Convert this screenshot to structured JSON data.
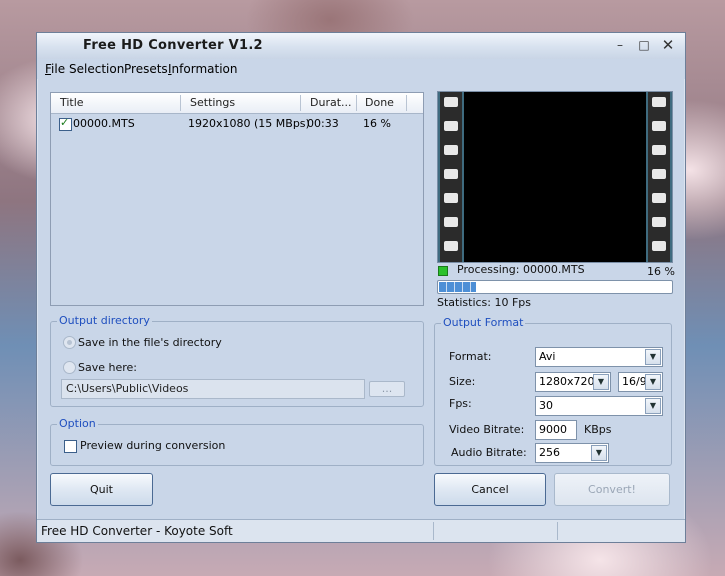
{
  "window": {
    "title": "Free HD Converter V1.2"
  },
  "menu": [
    {
      "label": "File",
      "accel": "F",
      "rest": "ile"
    },
    {
      "label": "Selection"
    },
    {
      "label": "Presets"
    },
    {
      "label": "Information",
      "accel": "I",
      "rest": "nformation"
    }
  ],
  "list": {
    "columns": [
      "Title",
      "Settings",
      "Durat...",
      "Done"
    ],
    "rows": [
      {
        "checked": true,
        "title": "00000.MTS",
        "settings": "1920x1080 (15 MBps)",
        "duration": "00:33",
        "done": "16 %"
      }
    ]
  },
  "processing": {
    "label": "Processing: 00000.MTS",
    "percent_text": "16 %",
    "progress_fraction": 0.16,
    "statistics": "Statistics: 10 Fps"
  },
  "output_directory": {
    "legend": "Output directory",
    "option1": "Save in the file's directory",
    "option2": "Save here:",
    "path": "C:\\Users\\Public\\Videos",
    "browse_label": "..."
  },
  "option": {
    "legend": "Option",
    "preview_label": "Preview during conversion"
  },
  "output_format": {
    "legend": "Output Format",
    "format_label": "Format:",
    "format_value": "Avi",
    "size_label": "Size:",
    "size_value": "1280x720",
    "aspect_value": "16/9",
    "fps_label": "Fps:",
    "fps_value": "30",
    "video_bitrate_label": "Video Bitrate:",
    "video_bitrate_value": "9000",
    "video_bitrate_unit": "KBps",
    "audio_bitrate_label": "Audio Bitrate:",
    "audio_bitrate_value": "256"
  },
  "buttons": {
    "quit": "Quit",
    "cancel": "Cancel",
    "convert": "Convert!"
  },
  "statusbar": {
    "text": "Free HD Converter - Koyote Soft"
  },
  "colors": {
    "accent": "#1f4fbf",
    "window": "#c9d6e8",
    "processing_dot": "#2bc12b"
  }
}
